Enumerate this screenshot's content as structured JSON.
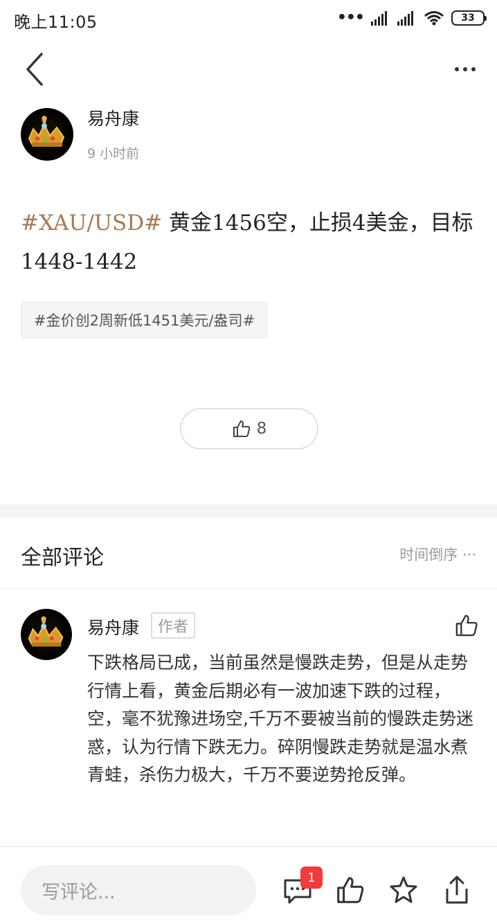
{
  "status_bar": {
    "time": "晚上11:05",
    "battery": "33"
  },
  "nav": {
    "back_icon": "chevron-left-icon",
    "more_icon": "more-dots-icon"
  },
  "post": {
    "author_name": "易舟康",
    "time_ago": "9 小时前",
    "hashtag": "#XAU/USD#",
    "text_line1": " 黄金1456空，止损4美金，目标",
    "text_line2": "1448-1442",
    "topic_tag": "#金价创2周新低1451美元/盎司#",
    "like_count": "8"
  },
  "comments": {
    "title": "全部评论",
    "sort_label": "时间倒序",
    "items": [
      {
        "author_name": "易舟康",
        "badge": "作者",
        "text": "下跌格局已成，当前虽然是慢跌走势，但是从走势行情上看，黄金后期必有一波加速下跌的过程，空，毫不犹豫进场空,千万不要被当前的慢跌走势迷惑，认为行情下跌无力。碎阴慢跌走势就是温水煮青蛙，杀伤力极大，千万不要逆势抢反弹。"
      }
    ]
  },
  "bottom_bar": {
    "input_placeholder": "写评论...",
    "comment_badge": "1"
  },
  "colors": {
    "accent_hashtag": "#a87852",
    "badge_red": "#f03c3c"
  }
}
